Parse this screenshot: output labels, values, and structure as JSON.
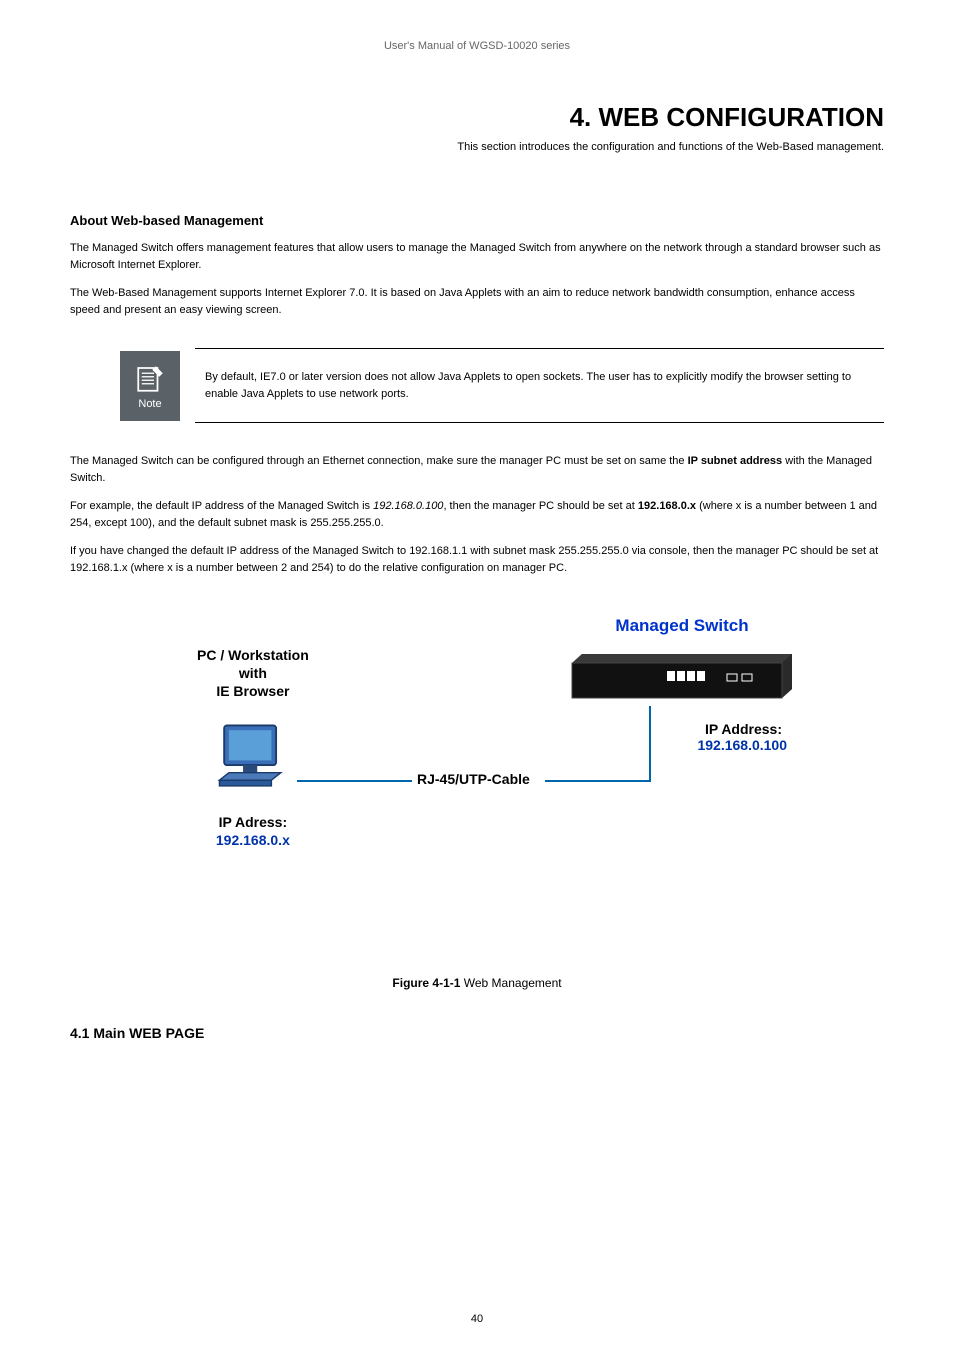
{
  "header": {
    "manual_title": "User's Manual of WGSD-10020 series"
  },
  "chapter": {
    "title": "4. WEB CONFIGURATION",
    "subtitle": "This section introduces the configuration and functions of the Web-Based management."
  },
  "section_about": {
    "heading": "About Web-based Management",
    "para1": "The Managed Switch offers management features that allow users to manage the Managed Switch from anywhere on the network through a standard browser such as Microsoft Internet Explorer.",
    "para2": "The Web-Based Management supports Internet Explorer 7.0. It is based on Java Applets with an aim to reduce network bandwidth consumption, enhance access speed and present an easy viewing screen."
  },
  "note": {
    "label": "Note",
    "content": "By default, IE7.0 or later version does not allow Java Applets to open sockets. The user has to explicitly modify the browser setting to enable Java Applets to use network ports."
  },
  "body_after_note": {
    "para1_prefix": "The Managed Switch can be configured through an Ethernet connection, make sure the manager PC must be set on same the ",
    "para1_bold": "IP subnet address",
    "para1_suffix": " with the Managed Switch.",
    "para2_prefix": "For example, the default IP address of the Managed Switch is ",
    "para2_italic": "192.168.0.100",
    "para2_mid": ", then the manager PC should be set at ",
    "para2_bold": "192.168.0.x",
    "para2_paren": " (where x is a number between 1 and 254, except 100), and the default subnet mask is 255.255.255.0.",
    "para3_prefix": "If you have changed the default IP address of the Managed Switch to 192.168.1.1 with subnet mask 255.255.255.0 via console, then the manager PC should be set at 192.168.1.x (where x is a number between 2 and 254) to do the relative configuration on manager PC."
  },
  "diagram": {
    "pc_label_line1": "PC / Workstation",
    "pc_label_line2": "with",
    "pc_label_line3": "IE Browser",
    "pc_ip_label": "IP Adress:",
    "pc_ip_value": "192.168.0.x",
    "switch_title": "Managed Switch",
    "switch_ip_label": "IP Address:",
    "switch_ip_value": "192.168.0.100",
    "cable_label": "RJ-45/UTP-Cable",
    "figure_caption_prefix": "Figure 4-1-1",
    "figure_caption_suffix": " Web Management"
  },
  "section_4_1": {
    "number": "4.1 Main WEB PAGE"
  },
  "footer": {
    "page_number": "40"
  }
}
